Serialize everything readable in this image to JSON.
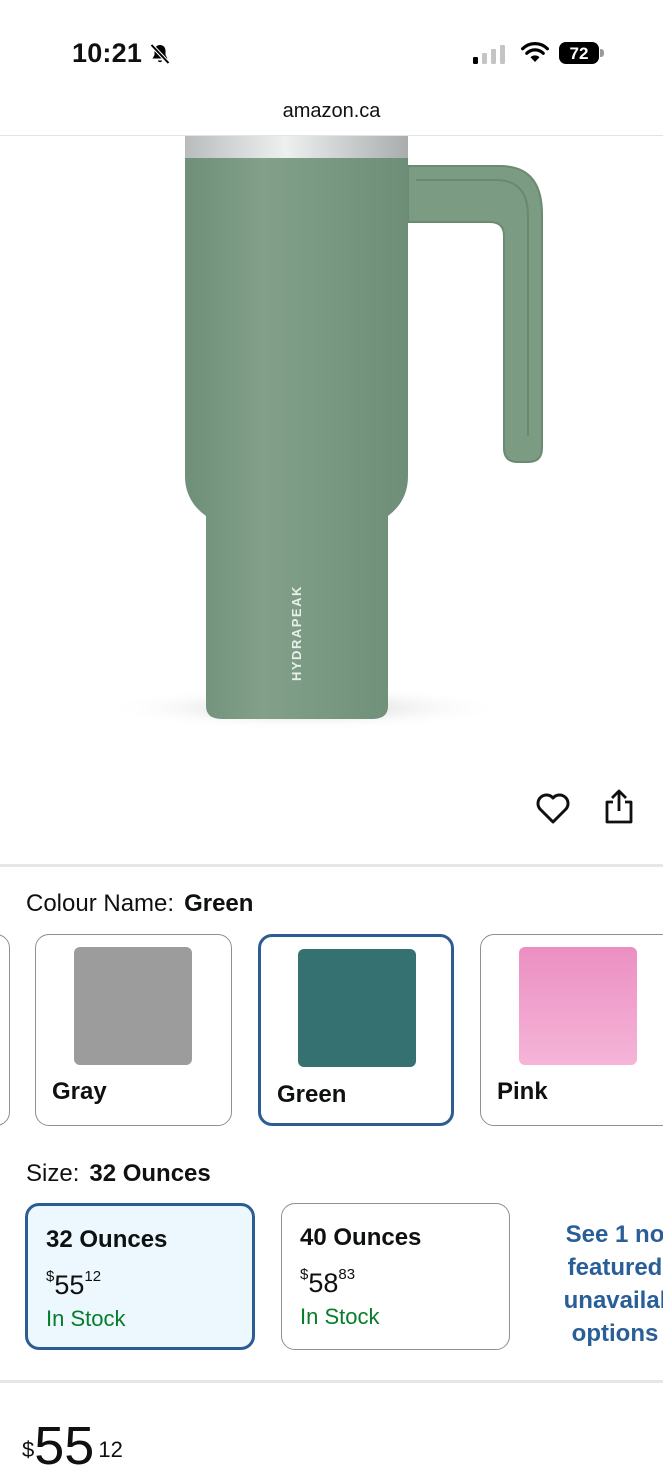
{
  "status_bar": {
    "time": "10:21",
    "battery": "72"
  },
  "browser": {
    "url": "amazon.ca"
  },
  "product_image": {
    "brand_text": "HYDRAPEAK"
  },
  "colour": {
    "label": "Colour Name:",
    "selected": "Green",
    "options": [
      {
        "name": "Gray",
        "swatch": "#9c9c9d"
      },
      {
        "name": "Green",
        "swatch": "#357170"
      },
      {
        "name": "Pink",
        "swatch": "#ef91c4"
      }
    ]
  },
  "size": {
    "label": "Size:",
    "selected": "32 Ounces",
    "options": [
      {
        "name": "32 Ounces",
        "currency": "$",
        "whole": "55",
        "fraction": "12",
        "stock": "In Stock"
      },
      {
        "name": "40 Ounces",
        "currency": "$",
        "whole": "58",
        "fraction": "83",
        "stock": "In Stock"
      }
    ],
    "see_more": [
      "See 1 no",
      "featured",
      "unavailal",
      "options"
    ]
  },
  "price": {
    "currency": "$",
    "whole": "55",
    "fraction": "12"
  },
  "colors": {
    "link": "#2a5e99",
    "in_stock": "#067d2a",
    "selected_border": "#2d5c93",
    "product_body": "#7a9a82"
  }
}
